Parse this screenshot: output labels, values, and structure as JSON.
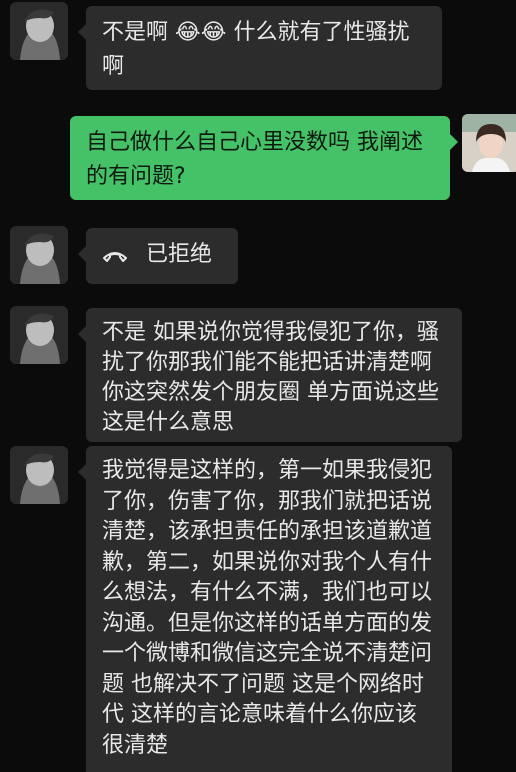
{
  "messages": [
    {
      "side": "in",
      "text_a": "不是啊",
      "emoji": "😂😂",
      "text_b": "什么就有了性骚扰啊"
    },
    {
      "side": "out",
      "text": "自己做什么自己心里没数吗 我阐述的有问题?"
    },
    {
      "side": "in",
      "call_icon": "phone-hangup-icon",
      "text": "已拒绝"
    },
    {
      "side": "in",
      "text": "不是 如果说你觉得我侵犯了你，骚扰了你那我们能不能把话讲清楚啊  你这突然发个朋友圈   单方面说这些  这是什么意思"
    },
    {
      "side": "in",
      "text": "我觉得是这样的，第一如果我侵犯了你，伤害了你，那我们就把话说清楚，该承担责任的承担该道歉道歉，第二，如果说你对我个人有什么想法，有什么不满，我们也可以沟通。但是你这样的话单方面的发一个微博和微信这完全说不清楚问题  也解决不了问题  这是个网络时代  这样的言论意味着什么你应该很清楚"
    }
  ]
}
